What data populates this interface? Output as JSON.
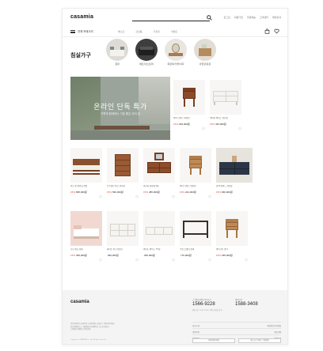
{
  "header": {
    "logo": "casamia",
    "util_links": [
      "로그인",
      "회원가입",
      "주문배송",
      "고객센터",
      "매장안내"
    ],
    "menu_label": "전체 카테고리",
    "nav_items": [
      "베스트",
      "신상품",
      "기획전",
      "이벤트"
    ]
  },
  "category": {
    "title": "침실가구",
    "items": [
      {
        "label": "침대"
      },
      {
        "label": "매트리스/토퍼"
      },
      {
        "label": "화장대/거울/의자"
      },
      {
        "label": "서랍장/옷장"
      }
    ]
  },
  "banner": {
    "headline": "온라인 단독 특가",
    "sub": "가족과 함께하는 기분 좋은 우리 집"
  },
  "products": [
    {
      "name": "엘리 나이트 테이블",
      "strike": "",
      "pct": "15%",
      "price": "299,000원"
    },
    {
      "name": "데이지 와이드 서랍장",
      "strike": "",
      "pct": "15%",
      "price": "445,000원"
    },
    {
      "name": "플로 퀸 침대 프레임",
      "strike": "",
      "pct": "15%",
      "price": "895,000원"
    },
    {
      "name": "브루클린 높은 서랍장",
      "strike": "",
      "pct": "15%",
      "price": "560,000원"
    },
    {
      "name": "라운지 화장대 세트",
      "strike": "",
      "pct": "15%",
      "price": "485,000원"
    },
    {
      "name": "엘리 나이트 테이블",
      "strike": "",
      "pct": "15%",
      "price": "244,000원"
    },
    {
      "name": "블랙 와이드 서랍장",
      "strike": "",
      "pct": "15%",
      "price": "660,000원"
    },
    {
      "name": "모던 싱글 침대",
      "strike": "",
      "pct": "15%",
      "price": "395,000원"
    },
    {
      "name": "화이트 3단 서랍장",
      "strike": "",
      "pct": "",
      "price": "990,000원"
    },
    {
      "name": "화이트 와이드 TV장",
      "strike": "",
      "pct": "",
      "price": "355,000원"
    },
    {
      "name": "스틸 프레임 침대",
      "strike": "",
      "pct": "",
      "price": "770,000원"
    },
    {
      "name": "엘리 2단 협탁",
      "strike": "",
      "pct": "15%",
      "price": "185,000원"
    }
  ],
  "footer": {
    "logo": "casamia",
    "cs_label": "고객센터(평일 09-18시)",
    "cs_phone": "1566-9228",
    "cs_hours": "점심시간 12:00-13:00 / 주말·공휴일 휴무",
    "cs2_label": "매장문의",
    "cs2_phone": "1588-3408",
    "info_lines": [
      "(주)까사미아 | 대표이사 | 서울특별시 강남구 | 사업자등록번호",
      "통신판매업신고 | 개인정보보호책임자 | 호스팅 제공자",
      "고객센터 이메일 | 문의 안내"
    ],
    "copyright": "Copyright © CASAMIA Co., Ltd. All rights reserved.",
    "links": [
      {
        "left": "회사소개",
        "right": "개인정보처리방침"
      },
      {
        "left": "이용약관",
        "right": "제휴문의"
      },
      {
        "left": "입점문의",
        "right": "매장안내"
      }
    ],
    "btn1": "사업자정보확인",
    "btn2": "에스크로 서비스 가입확인"
  },
  "colors": {
    "accent_red": "#e0463a",
    "footer_bg": "#f4f4f4",
    "banner_green": "#9aa49a"
  }
}
